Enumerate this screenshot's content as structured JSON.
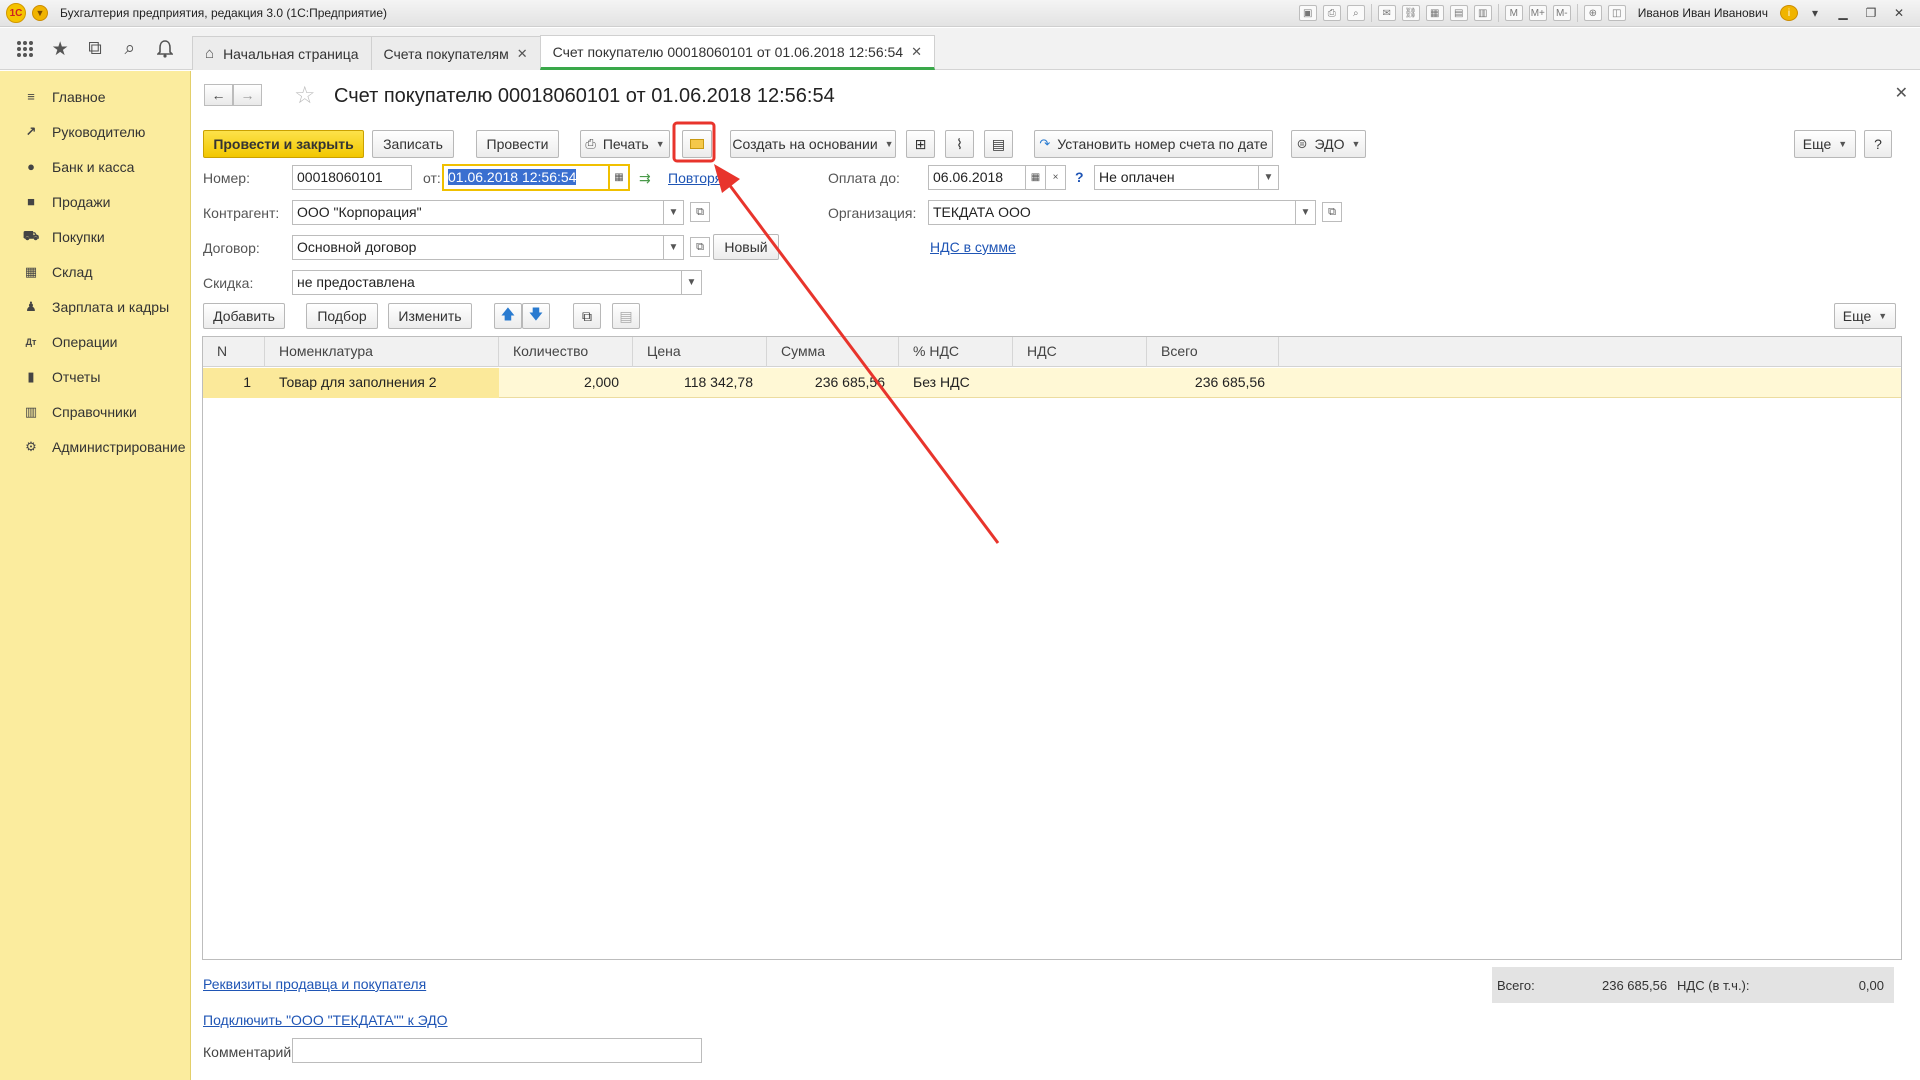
{
  "app": {
    "title": "Бухгалтерия предприятия, редакция 3.0  (1С:Предприятие)",
    "logo_text": "1С",
    "user": "Иванов Иван Иванович",
    "toolbar_letters": [
      "M",
      "M+",
      "M-"
    ]
  },
  "tabs": [
    {
      "label": "Начальная страница",
      "closable": false
    },
    {
      "label": "Счета покупателям",
      "closable": true
    },
    {
      "label": "Счет покупателю 00018060101 от 01.06.2018 12:56:54",
      "closable": true
    }
  ],
  "sidebar": {
    "items": [
      {
        "label": "Главное",
        "icon": "menu-icon"
      },
      {
        "label": "Руководителю",
        "icon": "chart-line-icon"
      },
      {
        "label": "Банк и касса",
        "icon": "coin-icon"
      },
      {
        "label": "Продажи",
        "icon": "bag-icon"
      },
      {
        "label": "Покупки",
        "icon": "cart-icon"
      },
      {
        "label": "Склад",
        "icon": "warehouse-icon"
      },
      {
        "label": "Зарплата и кадры",
        "icon": "person-icon"
      },
      {
        "label": "Операции",
        "icon": "debit-credit-icon"
      },
      {
        "label": "Отчеты",
        "icon": "bar-chart-icon"
      },
      {
        "label": "Справочники",
        "icon": "books-icon"
      },
      {
        "label": "Администрирование",
        "icon": "gear-icon"
      }
    ]
  },
  "document": {
    "title": "Счет покупателю 00018060101 от 01.06.2018 12:56:54"
  },
  "toolbar": {
    "post_close": "Провести и закрыть",
    "save": "Записать",
    "post": "Провести",
    "print": "Печать",
    "create_based": "Создать на основании",
    "set_number": "Установить номер счета по дате",
    "edo": "ЭДО",
    "more": "Еще",
    "help": "?"
  },
  "fields": {
    "number_label": "Номер:",
    "number": "00018060101",
    "date_label": "от:",
    "date": "01.06.2018 12:56:54",
    "repeat_link": "Повторя",
    "pay_until_label": "Оплата до:",
    "pay_until": "06.06.2018",
    "pay_status": "Не оплачен",
    "counterparty_label": "Контрагент:",
    "counterparty": "ООО \"Корпорация\"",
    "org_label": "Организация:",
    "org": "ТЕКДАТА ООО",
    "contract_label": "Договор:",
    "contract": "Основной договор",
    "new_btn": "Новый",
    "vat_link": "НДС в сумме",
    "discount_label": "Скидка:",
    "discount": "не предоставлена"
  },
  "table_toolbar": {
    "add": "Добавить",
    "pick": "Подбор",
    "change": "Изменить",
    "more": "Еще"
  },
  "table": {
    "columns": [
      "N",
      "Номенклатура",
      "Количество",
      "Цена",
      "Сумма",
      "% НДС",
      "НДС",
      "Всего"
    ],
    "rows": [
      [
        "1",
        "Товар для заполнения 2",
        "2,000",
        "118 342,78",
        "236 685,56",
        "Без НДС",
        "",
        "236 685,56"
      ]
    ]
  },
  "footer": {
    "requisites_link": "Реквизиты продавца и покупателя",
    "edo_link": "Подключить \"ООО \"ТЕКДАТА\"\" к ЭДО",
    "comment_label": "Комментарий:",
    "comment": "",
    "total_label": "Всего:",
    "total": "236 685,56",
    "vat_label": "НДС (в т.ч.):",
    "vat": "0,00"
  },
  "colors": {
    "sidebar_bg": "#fbec9e",
    "primary_button": "#f2c700",
    "active_tab_underline": "#3aa84a",
    "selected_row": "#fff8d5",
    "annotation": "#e8342c",
    "link": "#1f55b5"
  }
}
